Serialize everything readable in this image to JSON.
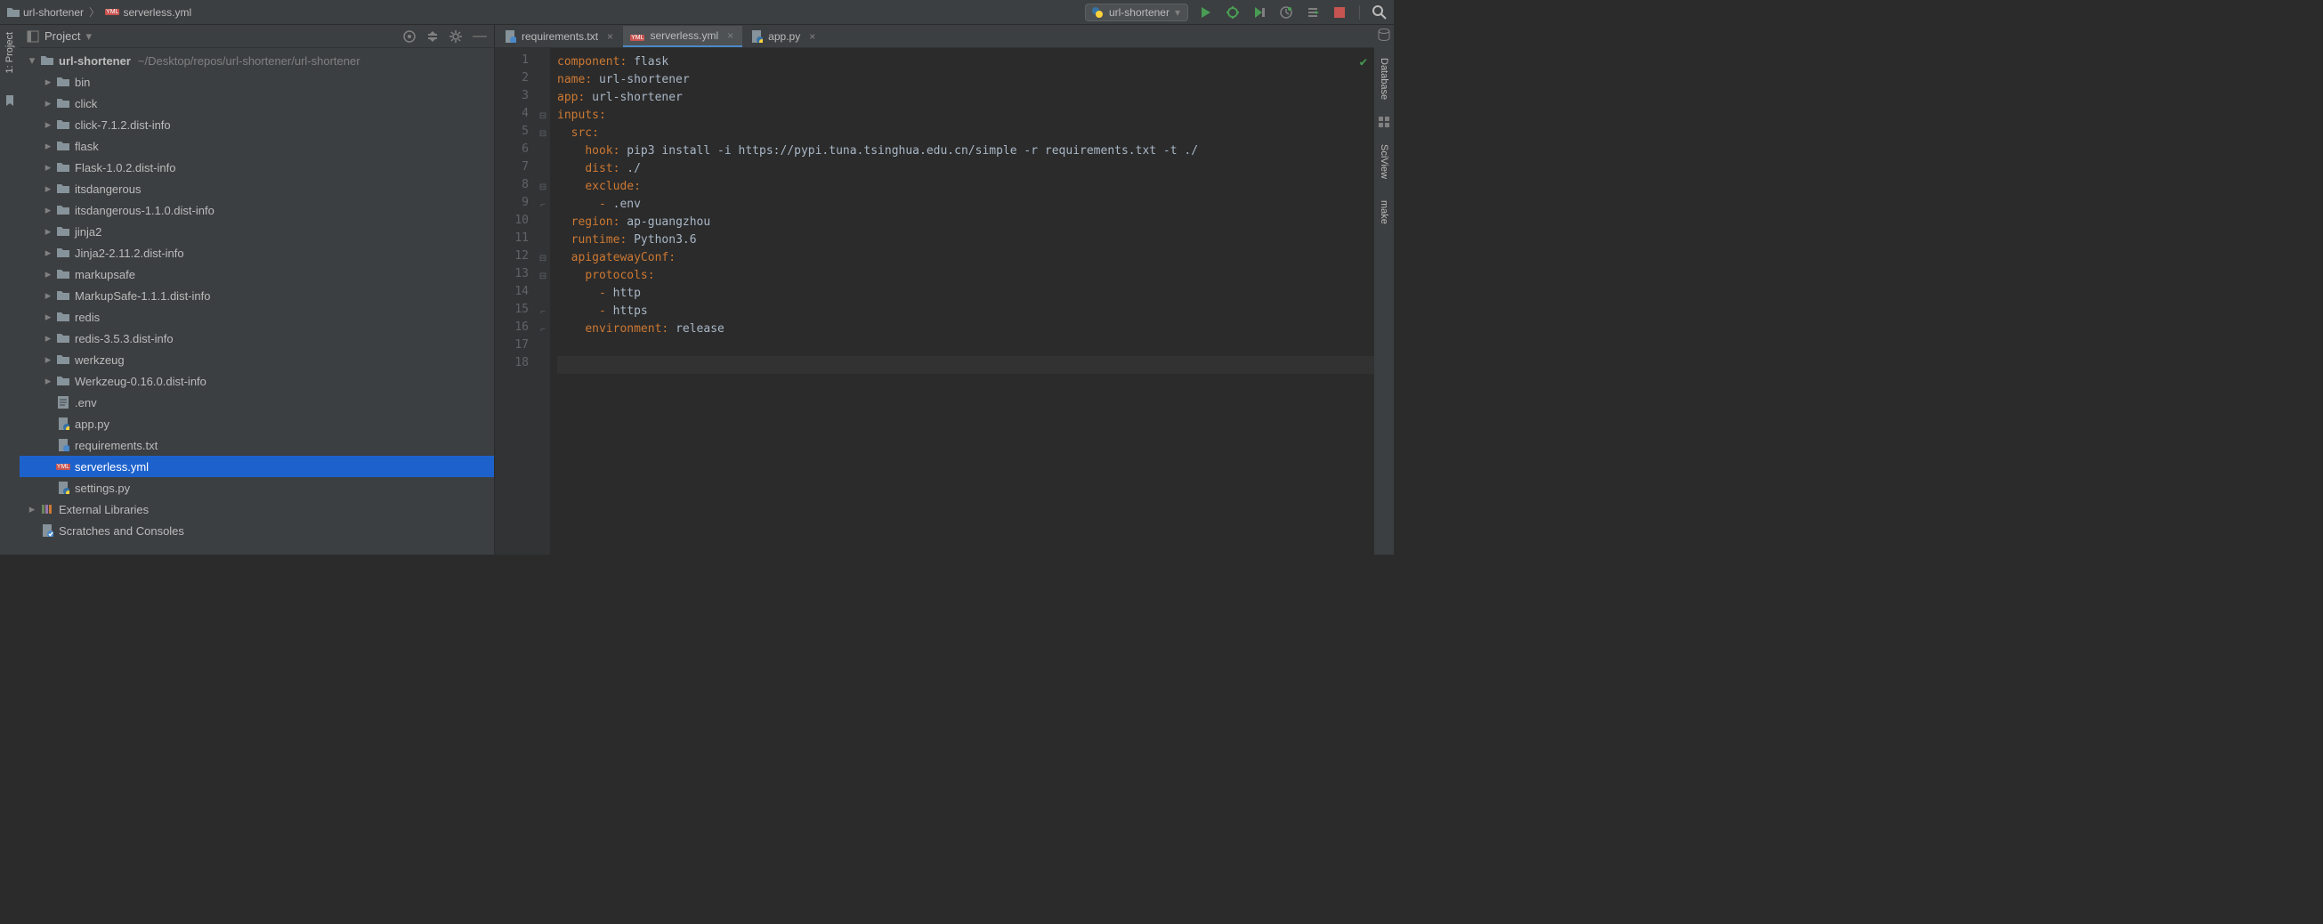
{
  "breadcrumbs": {
    "root": "url-shortener",
    "file": "serverless.yml"
  },
  "run_config": {
    "name": "url-shortener"
  },
  "left_strip": {
    "project_tab": "1: Project"
  },
  "right_strip": {
    "database_tab": "Database",
    "sciview_tab": "SciView",
    "make_tab": "make"
  },
  "project_header": {
    "title": "Project"
  },
  "project_tree": [
    {
      "indent": 0,
      "arrow": "down",
      "icon": "folder",
      "label": "url-shortener",
      "sublabel": "~/Desktop/repos/url-shortener/url-shortener",
      "bold": true
    },
    {
      "indent": 1,
      "arrow": "right",
      "icon": "folder",
      "label": "bin"
    },
    {
      "indent": 1,
      "arrow": "right",
      "icon": "folder",
      "label": "click"
    },
    {
      "indent": 1,
      "arrow": "right",
      "icon": "folder",
      "label": "click-7.1.2.dist-info"
    },
    {
      "indent": 1,
      "arrow": "right",
      "icon": "folder",
      "label": "flask"
    },
    {
      "indent": 1,
      "arrow": "right",
      "icon": "folder",
      "label": "Flask-1.0.2.dist-info"
    },
    {
      "indent": 1,
      "arrow": "right",
      "icon": "folder",
      "label": "itsdangerous"
    },
    {
      "indent": 1,
      "arrow": "right",
      "icon": "folder",
      "label": "itsdangerous-1.1.0.dist-info"
    },
    {
      "indent": 1,
      "arrow": "right",
      "icon": "folder",
      "label": "jinja2"
    },
    {
      "indent": 1,
      "arrow": "right",
      "icon": "folder",
      "label": "Jinja2-2.11.2.dist-info"
    },
    {
      "indent": 1,
      "arrow": "right",
      "icon": "folder",
      "label": "markupsafe"
    },
    {
      "indent": 1,
      "arrow": "right",
      "icon": "folder",
      "label": "MarkupSafe-1.1.1.dist-info"
    },
    {
      "indent": 1,
      "arrow": "right",
      "icon": "folder",
      "label": "redis"
    },
    {
      "indent": 1,
      "arrow": "right",
      "icon": "folder",
      "label": "redis-3.5.3.dist-info"
    },
    {
      "indent": 1,
      "arrow": "right",
      "icon": "folder",
      "label": "werkzeug"
    },
    {
      "indent": 1,
      "arrow": "right",
      "icon": "folder",
      "label": "Werkzeug-0.16.0.dist-info"
    },
    {
      "indent": 1,
      "arrow": "",
      "icon": "textfile",
      "label": ".env"
    },
    {
      "indent": 1,
      "arrow": "",
      "icon": "pyfile",
      "label": "app.py"
    },
    {
      "indent": 1,
      "arrow": "",
      "icon": "txtgear",
      "label": "requirements.txt"
    },
    {
      "indent": 1,
      "arrow": "",
      "icon": "yaml",
      "label": "serverless.yml",
      "selected": true
    },
    {
      "indent": 1,
      "arrow": "",
      "icon": "pyfile",
      "label": "settings.py"
    },
    {
      "indent": 0,
      "arrow": "right",
      "icon": "libs",
      "label": "External Libraries"
    },
    {
      "indent": 0,
      "arrow": "",
      "icon": "scratch",
      "label": "Scratches and Consoles"
    }
  ],
  "editor_tabs": [
    {
      "id": "requirements",
      "label": "requirements.txt",
      "icon": "txtgear",
      "active": false
    },
    {
      "id": "serverless",
      "label": "serverless.yml",
      "icon": "yaml",
      "active": true
    },
    {
      "id": "app",
      "label": "app.py",
      "icon": "pyfile",
      "active": false
    }
  ],
  "file_content": {
    "lines": [
      {
        "n": 1,
        "fold": "",
        "segments": [
          {
            "t": "component",
            "c": "key"
          },
          {
            "t": ": ",
            "c": "punct"
          },
          {
            "t": "flask",
            "c": "val"
          }
        ]
      },
      {
        "n": 2,
        "fold": "",
        "segments": [
          {
            "t": "name",
            "c": "key"
          },
          {
            "t": ": ",
            "c": "punct"
          },
          {
            "t": "url-shortener",
            "c": "val"
          }
        ]
      },
      {
        "n": 3,
        "fold": "",
        "segments": [
          {
            "t": "app",
            "c": "key"
          },
          {
            "t": ": ",
            "c": "punct"
          },
          {
            "t": "url-shortener",
            "c": "val"
          }
        ]
      },
      {
        "n": 4,
        "fold": "open",
        "segments": [
          {
            "t": "inputs",
            "c": "key"
          },
          {
            "t": ":",
            "c": "punct"
          }
        ]
      },
      {
        "n": 5,
        "fold": "open",
        "segments": [
          {
            "t": "  ",
            "c": "val"
          },
          {
            "t": "src",
            "c": "key"
          },
          {
            "t": ":",
            "c": "punct"
          }
        ]
      },
      {
        "n": 6,
        "fold": "",
        "segments": [
          {
            "t": "    ",
            "c": "val"
          },
          {
            "t": "hook",
            "c": "key"
          },
          {
            "t": ": ",
            "c": "punct"
          },
          {
            "t": "pip3 install -i https://pypi.tuna.tsinghua.edu.cn/simple -r requirements.txt -t ./",
            "c": "val"
          }
        ]
      },
      {
        "n": 7,
        "fold": "",
        "segments": [
          {
            "t": "    ",
            "c": "val"
          },
          {
            "t": "dist",
            "c": "key"
          },
          {
            "t": ": ",
            "c": "punct"
          },
          {
            "t": "./",
            "c": "val"
          }
        ]
      },
      {
        "n": 8,
        "fold": "open",
        "segments": [
          {
            "t": "    ",
            "c": "val"
          },
          {
            "t": "exclude",
            "c": "key"
          },
          {
            "t": ":",
            "c": "punct"
          }
        ]
      },
      {
        "n": 9,
        "fold": "end",
        "segments": [
          {
            "t": "      ",
            "c": "val"
          },
          {
            "t": "- ",
            "c": "dash"
          },
          {
            "t": ".env",
            "c": "val"
          }
        ]
      },
      {
        "n": 10,
        "fold": "",
        "segments": [
          {
            "t": "  ",
            "c": "val"
          },
          {
            "t": "region",
            "c": "key"
          },
          {
            "t": ": ",
            "c": "punct"
          },
          {
            "t": "ap-guangzhou",
            "c": "val"
          }
        ]
      },
      {
        "n": 11,
        "fold": "",
        "segments": [
          {
            "t": "  ",
            "c": "val"
          },
          {
            "t": "runtime",
            "c": "key"
          },
          {
            "t": ": ",
            "c": "punct"
          },
          {
            "t": "Python3.6",
            "c": "val"
          }
        ]
      },
      {
        "n": 12,
        "fold": "open",
        "segments": [
          {
            "t": "  ",
            "c": "val"
          },
          {
            "t": "apigatewayConf",
            "c": "key"
          },
          {
            "t": ":",
            "c": "punct"
          }
        ]
      },
      {
        "n": 13,
        "fold": "open",
        "segments": [
          {
            "t": "    ",
            "c": "val"
          },
          {
            "t": "protocols",
            "c": "key"
          },
          {
            "t": ":",
            "c": "punct"
          }
        ]
      },
      {
        "n": 14,
        "fold": "",
        "segments": [
          {
            "t": "      ",
            "c": "val"
          },
          {
            "t": "- ",
            "c": "dash"
          },
          {
            "t": "http",
            "c": "val"
          }
        ]
      },
      {
        "n": 15,
        "fold": "end",
        "segments": [
          {
            "t": "      ",
            "c": "val"
          },
          {
            "t": "- ",
            "c": "dash"
          },
          {
            "t": "https",
            "c": "val"
          }
        ]
      },
      {
        "n": 16,
        "fold": "end",
        "segments": [
          {
            "t": "    ",
            "c": "val"
          },
          {
            "t": "environment",
            "c": "key"
          },
          {
            "t": ": ",
            "c": "punct"
          },
          {
            "t": "release",
            "c": "val"
          }
        ]
      },
      {
        "n": 17,
        "fold": "",
        "segments": []
      },
      {
        "n": 18,
        "fold": "",
        "segments": [],
        "current": true
      }
    ]
  }
}
